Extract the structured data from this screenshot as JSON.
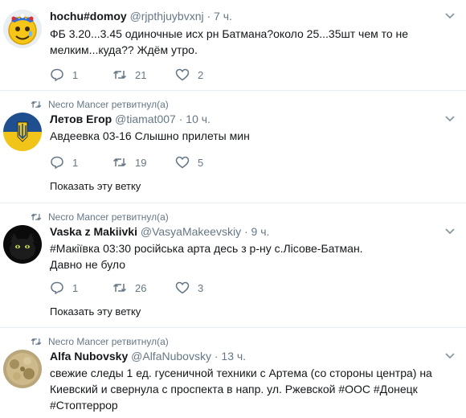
{
  "tweets": [
    {
      "retweeted_by": "",
      "name": "hochu#domoy",
      "handle": "@rjpthjuybvxnj",
      "dot": "·",
      "time": "7 ч.",
      "text_lines": [
        "ФБ 3.20...3.45 одиночные исх рн Батмана?около 25...35шт чем то не",
        "мелким...куда?? Ждём утро."
      ],
      "replies": "1",
      "retweets": "21",
      "likes": "2",
      "show_thread": ""
    },
    {
      "retweeted_by": "Necro Mancer ретвитнул(а)",
      "name": "Летов Егор",
      "handle": "@tiamat007",
      "dot": "·",
      "time": "10 ч.",
      "text_lines": [
        "Авдеевка 03-16 Слышно  прилеты мин"
      ],
      "replies": "1",
      "retweets": "19",
      "likes": "5",
      "show_thread": "Показать эту ветку"
    },
    {
      "retweeted_by": "Necro Mancer ретвитнул(а)",
      "name": "Vaska z Makiivki",
      "handle": "@VasyaMakeevskiy",
      "dot": "·",
      "time": "9 ч.",
      "text_lines": [
        "#Макіївка 03:30 російська арта десь з р-ну с.Лісове-Батман.",
        "Давно не було"
      ],
      "replies": "1",
      "retweets": "26",
      "likes": "3",
      "show_thread": "Показать эту ветку"
    },
    {
      "retweeted_by": "Necro Mancer ретвитнул(а)",
      "name": "Alfa Nubovsky",
      "handle": "@AlfaNubovsky",
      "dot": "·",
      "time": "13 ч.",
      "text_lines": [
        "свежие следы 1 ед. гусеничной техники с Артема (со стороны центра) на",
        "Киевский и свернула с проспекта в напр.  ул. Ржевской #ООС #Донецк",
        "#Стоптеррор"
      ],
      "replies": "",
      "retweets": "",
      "likes": "",
      "show_thread": ""
    }
  ],
  "colors": {
    "text": "#14171a",
    "secondary": "#657786",
    "divider": "#e6ecf0",
    "hashtag": "#14171a"
  },
  "icons": [
    "reply-icon",
    "retweet-icon",
    "like-icon",
    "chevron-down-icon",
    "retweet-indicator-icon"
  ]
}
